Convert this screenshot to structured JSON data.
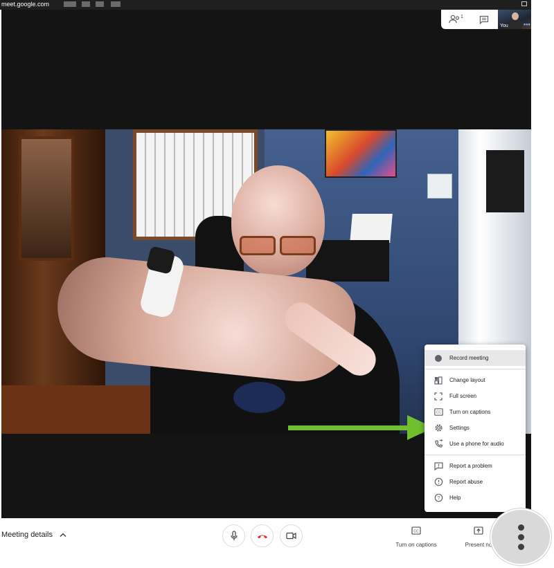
{
  "browser": {
    "url": "meet.google.com"
  },
  "self_view": {
    "label": "You"
  },
  "top_controls": {
    "participants_count": "1",
    "participants_icon": "people-icon",
    "chat_icon": "chat-icon"
  },
  "menu": {
    "items": [
      {
        "label": "Record meeting",
        "icon": "record-icon",
        "highlighted": true
      },
      {
        "label": "Change layout",
        "icon": "layout-icon"
      },
      {
        "label": "Full screen",
        "icon": "fullscreen-icon"
      },
      {
        "label": "Turn on captions",
        "icon": "captions-icon"
      },
      {
        "label": "Settings",
        "icon": "gear-icon"
      },
      {
        "label": "Use a phone for audio",
        "icon": "phone-audio-icon"
      },
      {
        "label": "Report a problem",
        "icon": "report-problem-icon"
      },
      {
        "label": "Report abuse",
        "icon": "report-abuse-icon"
      },
      {
        "label": "Help",
        "icon": "help-icon"
      }
    ]
  },
  "bottom_bar": {
    "meeting_details": "Meeting details",
    "captions_label": "Turn on captions",
    "present_label": "Present no"
  },
  "colors": {
    "arrow_green": "#6fbf2e",
    "hangup_red": "#d93025",
    "stage_bg": "#141414"
  }
}
